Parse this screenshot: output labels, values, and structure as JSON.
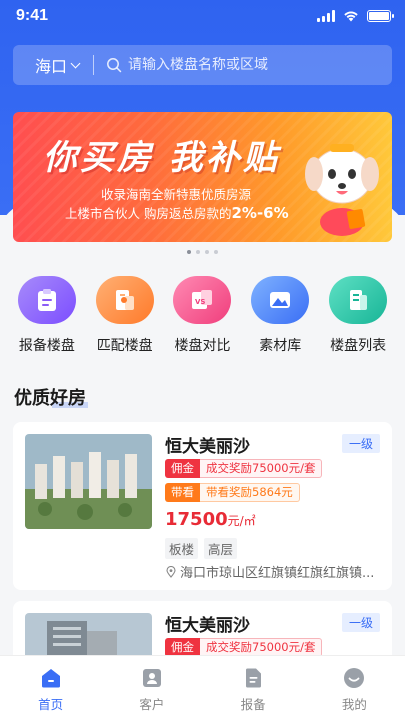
{
  "status_bar": {
    "time": "9:41"
  },
  "search": {
    "city": "海口",
    "placeholder": "请输入楼盘名称或区域"
  },
  "banner": {
    "title": "你买房 我补贴",
    "line1": "收录海南全新特惠优质房源",
    "line2_prefix": "上楼市合伙人 购房返总房款的",
    "line2_highlight": "2%-6%",
    "page_count": 4,
    "active_index": 0
  },
  "quick_nav": [
    {
      "label": "报备楼盘",
      "icon": "clipboard-icon",
      "color": "#8b5cf6"
    },
    {
      "label": "匹配楼盘",
      "icon": "match-building-icon",
      "color": "#ff8a3c"
    },
    {
      "label": "楼盘对比",
      "icon": "compare-icon",
      "color": "#f04e86"
    },
    {
      "label": "素材库",
      "icon": "image-library-icon",
      "color": "#3c7cf5"
    },
    {
      "label": "楼盘列表",
      "icon": "building-list-icon",
      "color": "#22c1a3"
    }
  ],
  "section": {
    "title": "优质好房"
  },
  "listings": [
    {
      "name": "恒大美丽沙",
      "level": "一级",
      "commission_key": "佣金",
      "commission_value": "成交奖励75000元/套",
      "visit_key": "带看",
      "visit_value": "带看奖励5864元",
      "price": "17500",
      "price_unit": "元/㎡",
      "tags": [
        "板楼",
        "高层"
      ],
      "address": "海口市琼山区红旗镇红旗红旗镇..."
    },
    {
      "name": "恒大美丽沙",
      "level": "一级",
      "commission_key": "佣金",
      "commission_value": "成交奖励75000元/套"
    }
  ],
  "tab_bar": [
    {
      "label": "首页",
      "icon": "home-icon",
      "active": true
    },
    {
      "label": "客户",
      "icon": "customer-icon",
      "active": false
    },
    {
      "label": "报备",
      "icon": "report-icon",
      "active": false
    },
    {
      "label": "我的",
      "icon": "profile-icon",
      "active": false
    }
  ],
  "colors": {
    "primary": "#3a6ef5",
    "price_red": "#e82b36",
    "tag_orange": "#ff7a1a"
  }
}
